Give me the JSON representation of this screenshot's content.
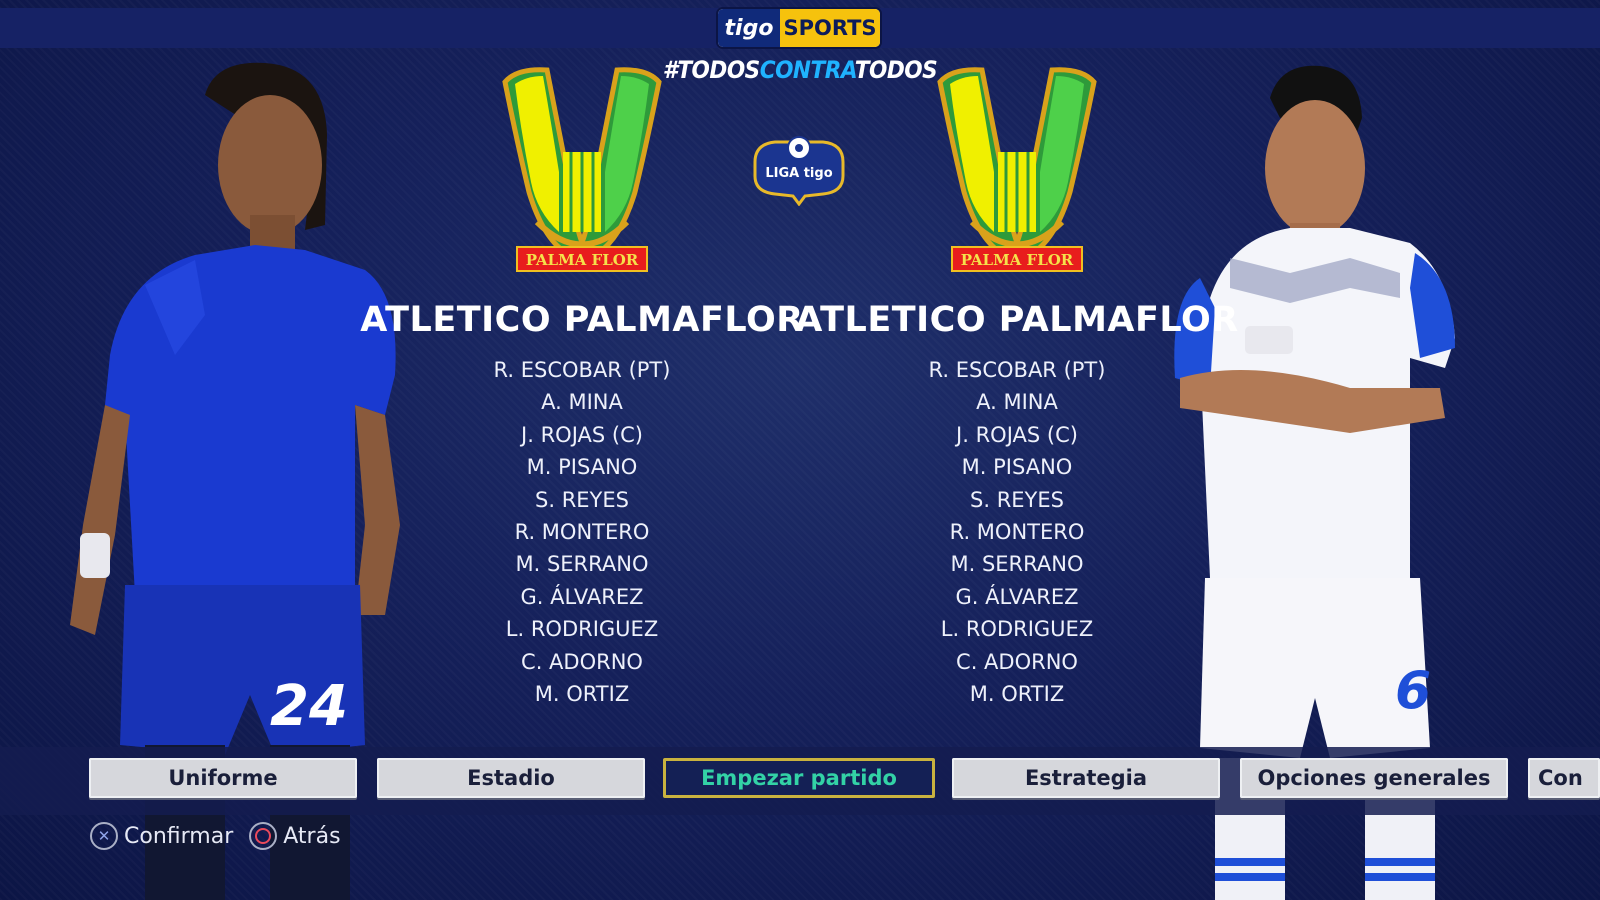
{
  "header": {
    "logo_tigo": "tigo",
    "logo_sports": "SPORTS",
    "hashtag_pre": "#TODOS",
    "hashtag_mid": "CONTRA",
    "hashtag_post": "TODOS",
    "league_logo": "LIGA tigo"
  },
  "home": {
    "crest_label": "PALMA FLOR",
    "team_name": "ATLETICO PALMAFLOR",
    "roster": [
      "R. ESCOBAR (PT)",
      "A. MINA",
      "J. ROJAS (C)",
      "M. PISANO",
      "S. REYES",
      "R. MONTERO",
      "M. SERRANO",
      "G. ÁLVAREZ",
      "L. RODRIGUEZ",
      "C. ADORNO",
      "M. ORTIZ"
    ],
    "kit_number": "24",
    "kit_color": "#1a3ad0"
  },
  "away": {
    "crest_label": "PALMA FLOR",
    "team_name": "ATLETICO PALMAFLOR",
    "roster": [
      "R. ESCOBAR (PT)",
      "A. MINA",
      "J. ROJAS (C)",
      "M. PISANO",
      "S. REYES",
      "R. MONTERO",
      "M. SERRANO",
      "G. ÁLVAREZ",
      "L. RODRIGUEZ",
      "C. ADORNO",
      "M. ORTIZ"
    ],
    "kit_number": "6",
    "kit_color": "#f4f5fa"
  },
  "menu": {
    "items": [
      "Uniforme",
      "Estadio",
      "Empezar partido",
      "Estrategia",
      "Opciones generales",
      "Con"
    ],
    "selected": "Empezar partido"
  },
  "hints": {
    "confirm": "Confirmar",
    "back": "Atrás"
  },
  "colors": {
    "background": "#15205a",
    "selected_text": "#33d2a6",
    "selected_border": "#c9b23f",
    "crest_yellow": "#f0f000",
    "crest_green": "#39b54a"
  }
}
